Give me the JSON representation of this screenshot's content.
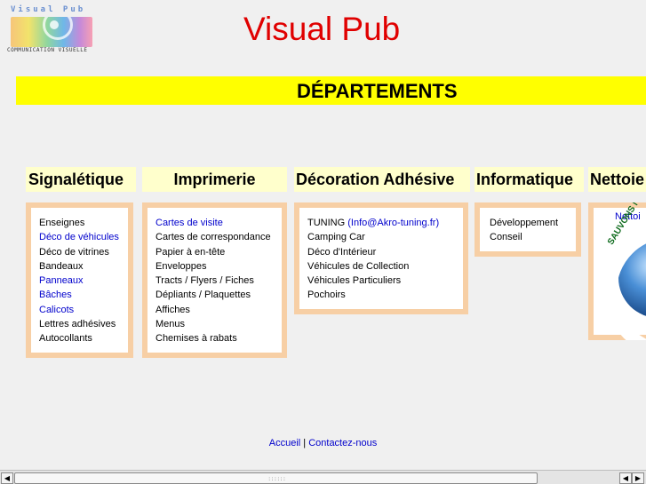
{
  "logo": {
    "title": "Visual Pub",
    "subtitle": "COMMUNICATION VISUELLE"
  },
  "site_title": "Visual Pub",
  "banner": "DÉPARTEMENTS",
  "categories": [
    {
      "title": "Signalétique",
      "items": [
        "Enseignes",
        "Déco de véhicules",
        "Déco de vitrines",
        "Bandeaux",
        "Panneaux",
        "Bâches",
        "Calicots",
        "Lettres adhésives",
        "Autocollants"
      ]
    },
    {
      "title": "Imprimerie",
      "items": [
        "Cartes de visite",
        "Cartes de correspondance",
        "Papier à en-tête",
        "Enveloppes",
        "Tracts / Flyers / Fiches",
        "Dépliants / Plaquettes",
        "Affiches",
        "Menus",
        "Chemises à rabats"
      ]
    },
    {
      "title": "Décoration Adhésive",
      "items": [
        "TUNING",
        "Camping Car",
        "Déco d'Intérieur",
        "Véhicules de Collection",
        "Véhicules Particuliers",
        "Pochoirs"
      ],
      "tuning_link": "(Info@Akro-tuning.fr)"
    },
    {
      "title": "Informatique",
      "items": [
        "Développement",
        "Conseil"
      ]
    },
    {
      "title": "Nettoie",
      "link": "Nettoi",
      "globe_text": "SAUVONS N"
    }
  ],
  "footer": {
    "home": "Accueil",
    "separator": "|",
    "contact": "Contactez-nous"
  },
  "scrollbar": {
    "left_icon": "arrow-left-icon",
    "right_icon": "arrow-right-icon",
    "grip": "::::::"
  }
}
